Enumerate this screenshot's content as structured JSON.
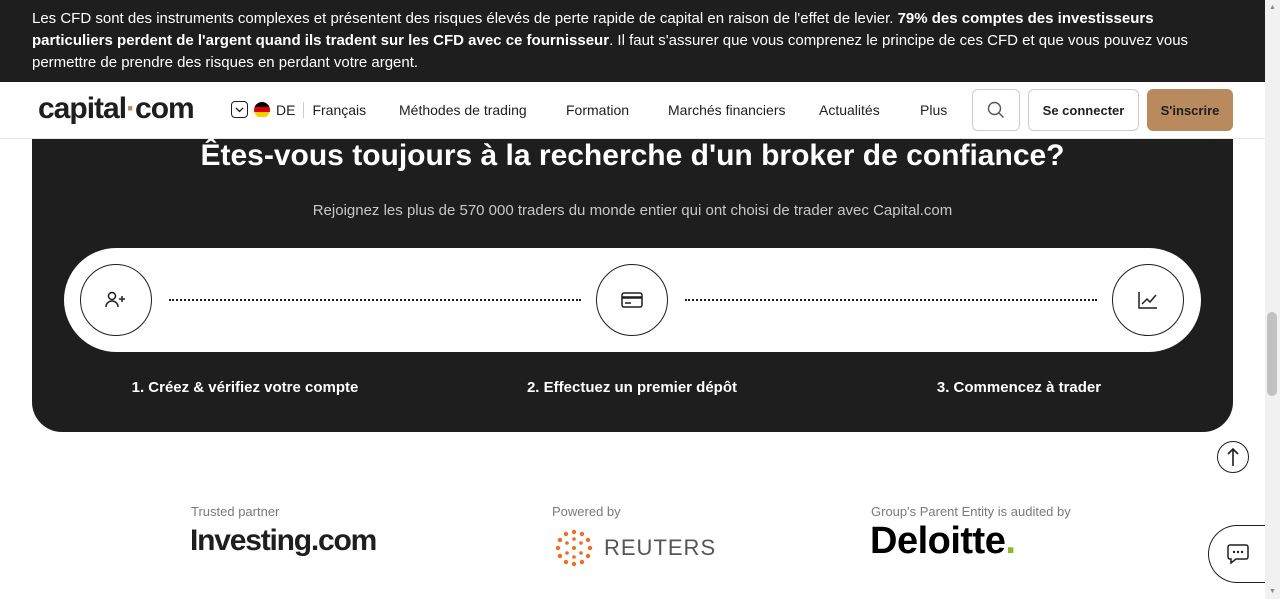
{
  "risk_banner": {
    "part1": "Les CFD sont des instruments complexes et présentent des risques élevés de perte rapide de capital en raison de l'effet de levier. ",
    "bold": "79% des comptes des investisseurs particuliers perdent de l'argent quand ils tradent sur les CFD avec ce fournisseur",
    "part2": ". Il faut s'assurer que vous comprenez le principe de ces CFD et que vous pouvez vous permettre de prendre des risques en perdant votre argent."
  },
  "header": {
    "logo_a": "capital",
    "logo_dot": "·",
    "logo_b": "com",
    "country": "DE",
    "language": "Français",
    "nav": [
      "Méthodes de trading",
      "Formation",
      "Marchés financiers",
      "Actualités",
      "Plus"
    ],
    "login": "Se connecter",
    "signup": "S'inscrire"
  },
  "cta": {
    "title": "Êtes-vous toujours à la recherche d'un broker de confiance?",
    "subtitle": "Rejoignez les plus de 570 000 traders du monde entier qui ont choisi de trader avec Capital.com",
    "steps": [
      {
        "label": "1. Créez & vérifiez votre compte",
        "icon": "add-user-icon"
      },
      {
        "label": "2. Effectuez un premier dépôt",
        "icon": "credit-card-icon"
      },
      {
        "label": "3. Commencez à trader",
        "icon": "chart-icon"
      }
    ]
  },
  "partners": [
    {
      "caption": "Trusted partner",
      "name": "Investing.com"
    },
    {
      "caption": "Powered by",
      "name": "REUTERS"
    },
    {
      "caption": "Group's Parent Entity is audited by",
      "name": "Deloitte."
    }
  ],
  "colors": {
    "dark": "#1f1e1e",
    "accent": "#b88a5e",
    "deloitte_green": "#86bc25",
    "reuters_orange": "#f26b21"
  }
}
